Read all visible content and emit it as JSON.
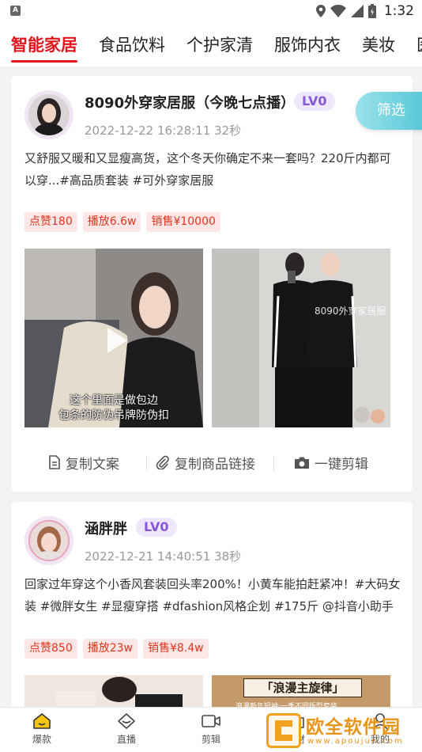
{
  "status_bar": {
    "time": "1:32",
    "notification_letter": "A"
  },
  "categories": [
    "智能家居",
    "食品饮料",
    "个护家清",
    "服饰内衣",
    "美妆",
    "医"
  ],
  "filter_label": "筛选",
  "posts": [
    {
      "name": "8090外穿家居服（今晚七点播）",
      "level": "LV0",
      "time": "2022-12-22 16:28:11 32秒",
      "text": "又舒服又暖和又显瘦高货，这个冬天你确定不来一套吗？220斤内都可以穿...#高品质套装 #可外穿家居服",
      "tags": [
        "点赞180",
        "播放6.6w",
        "销售¥10000"
      ],
      "photo1_caption_line1": "这个里面是做包边",
      "photo1_caption_line2": "包条的防伪吊牌防伪扣",
      "photo2_watermark": "8090外穿家居服",
      "actions": {
        "copy_text": "复制文案",
        "copy_link": "复制商品链接",
        "edit": "一键剪辑"
      }
    },
    {
      "name": "涵胖胖",
      "level": "LV0",
      "time": "2022-12-21 14:40:51 38秒",
      "text": "回家过年穿这个小香风套装回头率200%！小黄车能拍赶紧冲！#大码女装 #微胖女生 #显瘦穿搭 #dfashion风格企划 #175斤 @抖音小助手",
      "tags": [
        "点赞850",
        "播放23w",
        "销售¥8.4w"
      ],
      "photo2_banner": "「浪漫主旋律」",
      "photo2_sub": "浪漫新年短袖·一季不同版型套装"
    }
  ],
  "bottom_nav": [
    "爆款",
    "直播",
    "剪辑",
    "素材",
    "我的"
  ],
  "watermark": {
    "text": "欧全软件园",
    "url": "www.apoujun.com"
  },
  "colors": {
    "accent": "#e4141c",
    "badge": "#8558d8",
    "tag_text": "#e1341e",
    "filter": "#54c6d6"
  }
}
